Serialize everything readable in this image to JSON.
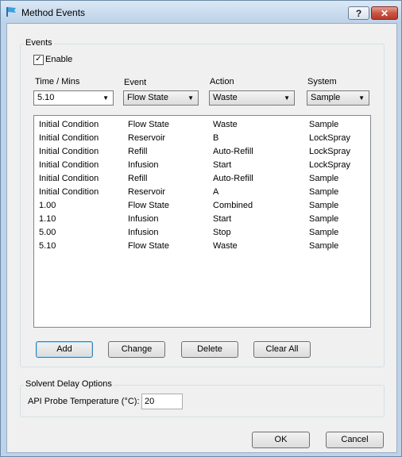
{
  "window": {
    "title": "Method Events",
    "help_label": "?",
    "close_label": "✕"
  },
  "events_group": {
    "label": "Events",
    "enable_label": "Enable",
    "enable_checked": true,
    "time_label": "Time / Mins",
    "time_value": "5.10",
    "event_label": "Event",
    "event_value": "Flow State",
    "action_label": "Action",
    "action_value": "Waste",
    "system_label": "System",
    "system_value": "Sample"
  },
  "events_list": [
    [
      "Initial Condition",
      "Flow State",
      "Waste",
      "Sample"
    ],
    [
      "Initial Condition",
      "Reservoir",
      "B",
      "LockSpray"
    ],
    [
      "Initial Condition",
      "Refill",
      "Auto-Refill",
      "LockSpray"
    ],
    [
      "Initial Condition",
      "Infusion",
      "Start",
      "LockSpray"
    ],
    [
      "Initial Condition",
      "Refill",
      "Auto-Refill",
      "Sample"
    ],
    [
      "Initial Condition",
      "Reservoir",
      "A",
      "Sample"
    ],
    [
      "1.00",
      "Flow State",
      "Combined",
      "Sample"
    ],
    [
      "1.10",
      "Infusion",
      "Start",
      "Sample"
    ],
    [
      "5.00",
      "Infusion",
      "Stop",
      "Sample"
    ],
    [
      "5.10",
      "Flow State",
      "Waste",
      "Sample"
    ]
  ],
  "buttons": {
    "add": "Add",
    "change": "Change",
    "delete": "Delete",
    "clear_all": "Clear All"
  },
  "solvent_group": {
    "label": "Solvent Delay Options",
    "probe_temp_label": "API Probe Temperature (°C):",
    "probe_temp_value": "20"
  },
  "footer": {
    "ok": "OK",
    "cancel": "Cancel"
  }
}
